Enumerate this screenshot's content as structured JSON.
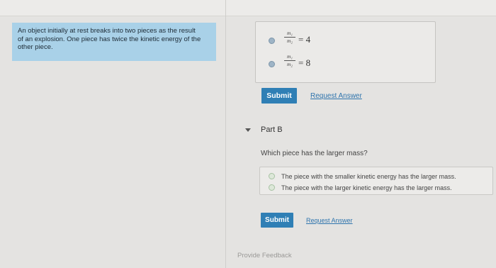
{
  "problem": {
    "text_line1": "An object initially at rest breaks into two pieces as the result",
    "text_line2": "of an explosion. One piece has twice the kinetic energy of the",
    "text_line3": "other piece."
  },
  "part_a": {
    "options": [
      {
        "numerator": "m₁",
        "denominator": "m₂",
        "equals": "= 4"
      },
      {
        "numerator": "m₁",
        "denominator": "m₂",
        "equals": "= 8"
      }
    ],
    "submit_label": "Submit",
    "request_answer_label": "Request Answer"
  },
  "part_b": {
    "label": "Part B",
    "question": "Which piece has the larger mass?",
    "choices": [
      "The piece with the smaller kinetic energy has the larger mass.",
      "The piece with the larger kinetic energy has the larger mass."
    ],
    "submit_label": "Submit",
    "request_answer_label": "Request Answer"
  },
  "footer": {
    "feedback_label": "Provide Feedback"
  }
}
